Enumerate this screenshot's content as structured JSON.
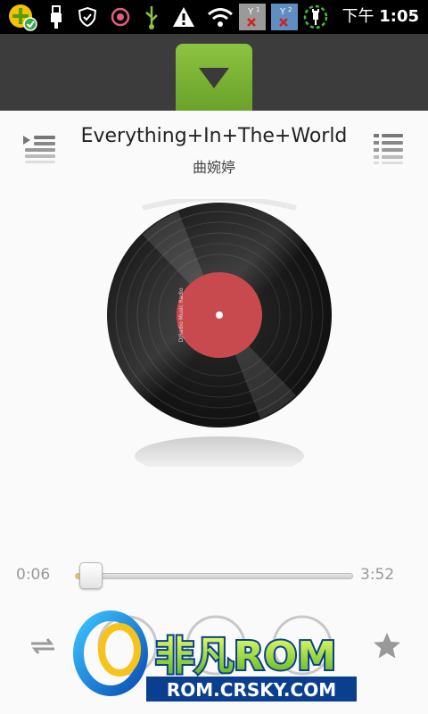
{
  "status_bar": {
    "icons": [
      "app-install-icon",
      "usb-icon",
      "shield-icon",
      "target-icon",
      "usb-debug-icon",
      "warning-icon",
      "wifi-icon",
      "sim1-no-signal-icon",
      "sim2-no-signal-icon",
      "charging-icon"
    ],
    "time_prefix": "下午",
    "time": "1:05"
  },
  "header": {
    "collapse_icon": "triangle-down-icon",
    "accent_color": "#7ab337"
  },
  "now_playing": {
    "title": "Everything+In+The+World",
    "artist": "曲婉婷",
    "disc_label": "DJRadio Music Radio"
  },
  "progress": {
    "elapsed": "0:06",
    "total": "3:52",
    "fraction": 0.026
  },
  "controls": {
    "left_icon": "repeat-icon",
    "right_icon": "star-icon",
    "middle_icons": [
      "previous-icon",
      "play-pause-icon",
      "next-icon"
    ]
  },
  "watermark": {
    "brand": "非凡ROM",
    "site": "ROM.CRSKY.COM"
  }
}
